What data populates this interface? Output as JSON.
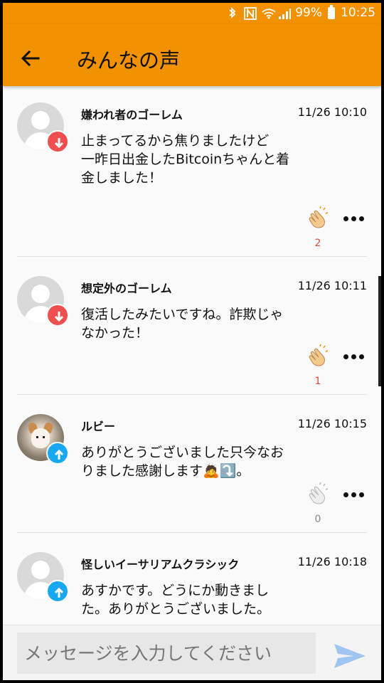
{
  "status": {
    "battery": "99%",
    "time": "10:25",
    "icons": [
      "bluetooth-icon",
      "nfc-icon",
      "wifi-icon",
      "signal-icon",
      "battery-icon"
    ]
  },
  "header": {
    "title": "みんなの声",
    "back_icon": "arrow-back-icon"
  },
  "messages": [
    {
      "name": "嫌われ者のゴーレム",
      "time": "11/26 10:10",
      "text": "止まってるから焦りましたけど\n一昨日出金したBitcoinちゃんと着\n金しました！",
      "badge": "down",
      "clap_count": "2",
      "clap_color": "#d54d42"
    },
    {
      "name": "想定外のゴーレム",
      "time": "11/26 10:11",
      "text": "復活したみたいですね。詐欺じゃ\nなかった！",
      "badge": "down",
      "clap_count": "1",
      "clap_color": "#d54d42"
    },
    {
      "name": "ルビー",
      "time": "11/26 10:15",
      "text": "ありがとうございました只今なお\nりました感謝します🙇⤵️。",
      "badge": "up",
      "clap_count": "0",
      "clap_color": "#888888"
    },
    {
      "name": "怪しいイーサリアムクラシック",
      "time": "11/26 10:18",
      "text": "あすかです。どうにか動きまし\nた。ありがとうございました。",
      "badge": "up"
    }
  ],
  "composer": {
    "placeholder": "メッセージを入力してください",
    "send_icon": "send-icon"
  },
  "colors": {
    "accent": "#f39200",
    "down_badge": "#ef4e4e",
    "up_badge": "#18a8f0",
    "send": "#9fc6f2"
  }
}
